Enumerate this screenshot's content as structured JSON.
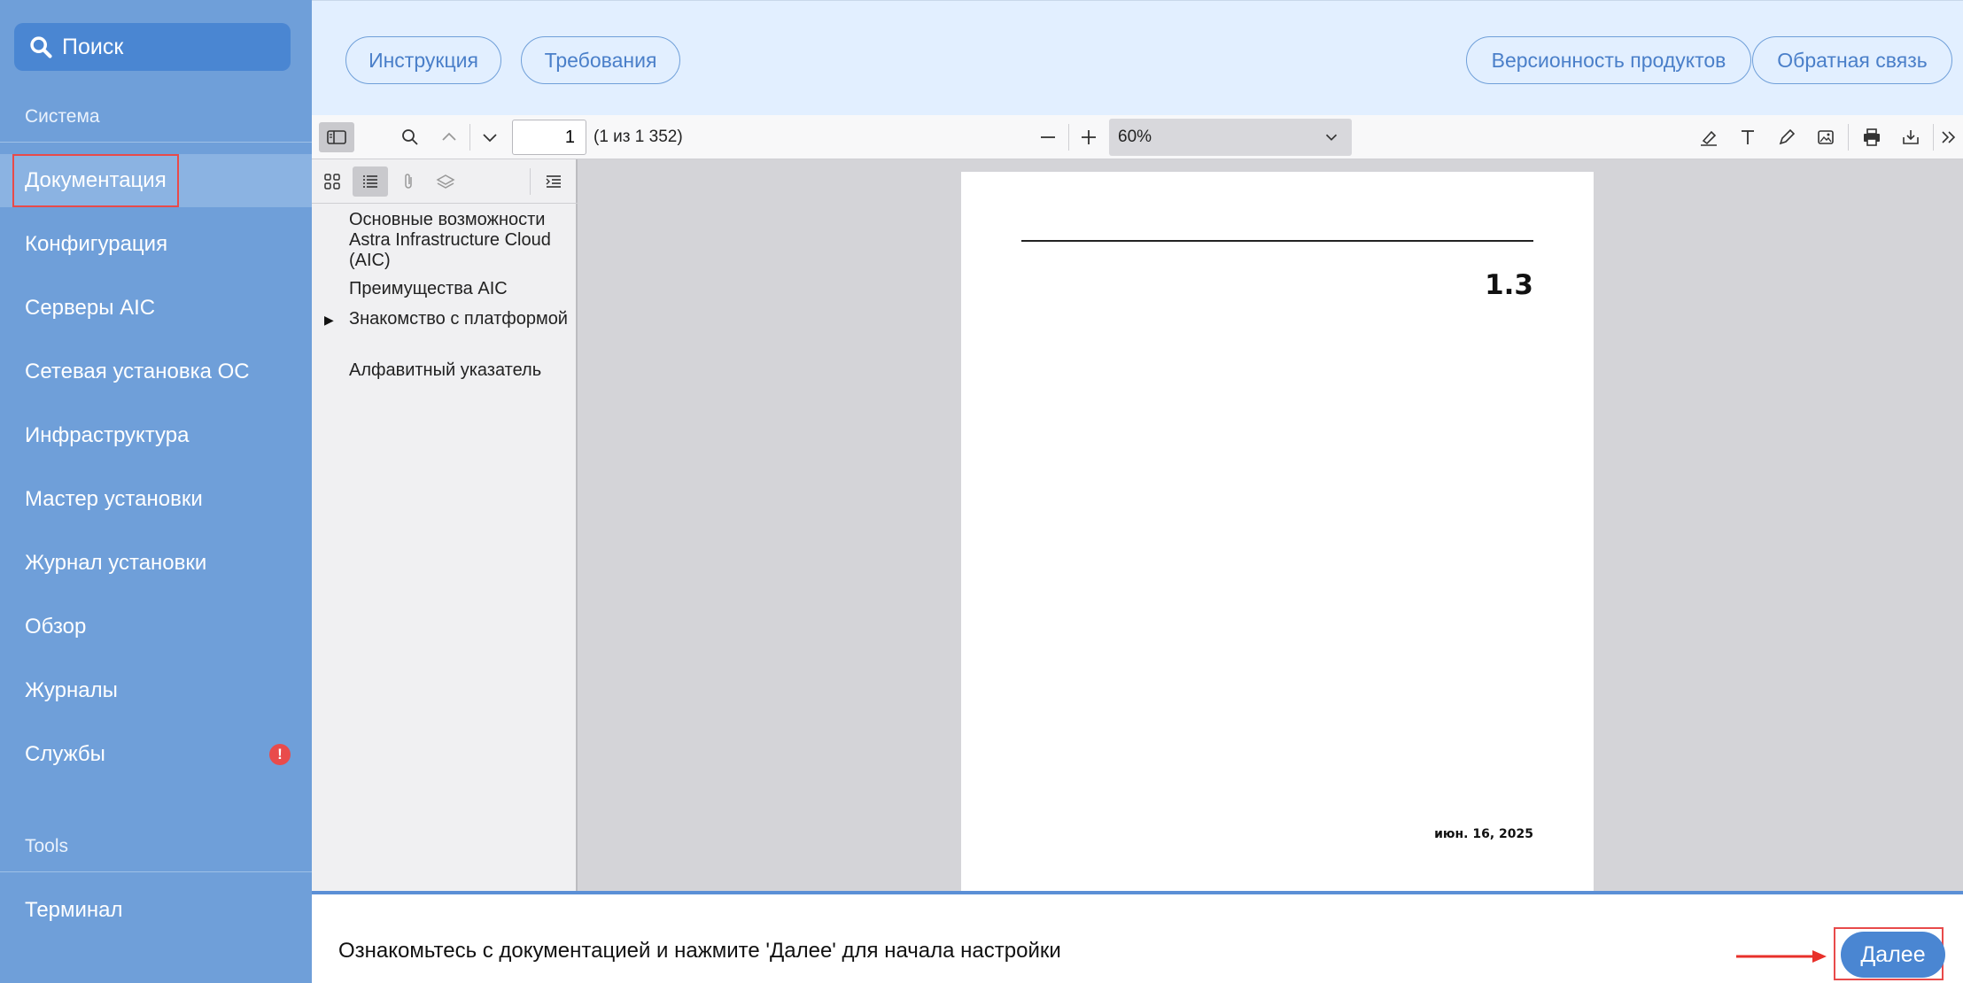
{
  "sidebar": {
    "search_label": "Поиск",
    "section_system": "Система",
    "items": [
      {
        "label": "Документация"
      },
      {
        "label": "Конфигурация"
      },
      {
        "label": "Серверы AIC"
      },
      {
        "label": "Сетевая установка ОС"
      },
      {
        "label": "Инфраструктура"
      },
      {
        "label": "Мастер установки"
      },
      {
        "label": "Журнал установки"
      },
      {
        "label": "Обзор"
      },
      {
        "label": "Журналы"
      },
      {
        "label": "Службы",
        "badge": "!"
      }
    ],
    "section_tools": "Tools",
    "tools_items": [
      {
        "label": "Терминал"
      }
    ]
  },
  "header": {
    "buttons_left": [
      "Инструкция",
      "Требования"
    ],
    "buttons_right": [
      "Версионность продуктов",
      "Обратная связь"
    ]
  },
  "viewer": {
    "page_number": "1",
    "page_count": "(1 из 1 352)",
    "zoom": "60%",
    "outline": [
      {
        "label": "Основные возможности Astra Infrastructure Cloud (AIC)"
      },
      {
        "label": "Преимущества AIC"
      },
      {
        "label": "Знакомство с платформой",
        "expandable": true
      },
      {
        "label": "Алфавитный указатель"
      }
    ],
    "page": {
      "version": "1.3",
      "date": "июн. 16, 2025"
    }
  },
  "footer": {
    "message": "Ознакомьтесь с документацией и нажмите 'Далее' для начала настройки",
    "next_label": "Далее"
  },
  "colors": {
    "sidebar": "#6f9fd9",
    "accent": "#4a86d2",
    "highlight": "#e84a4a"
  }
}
